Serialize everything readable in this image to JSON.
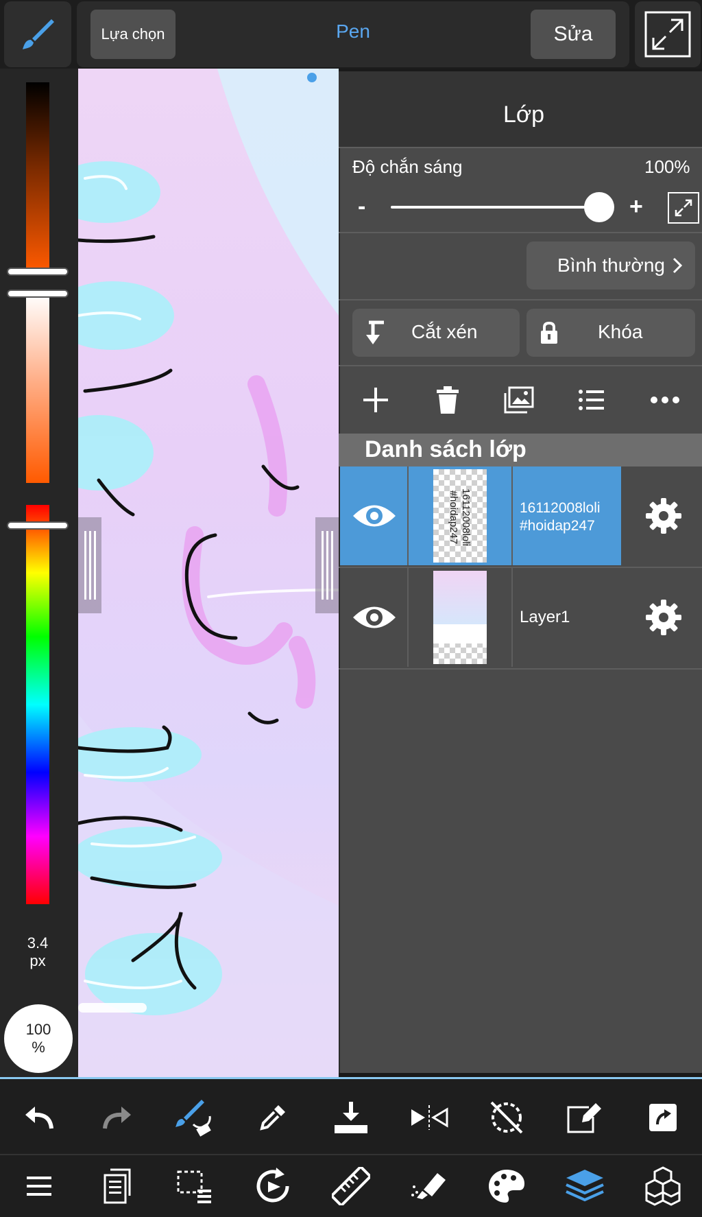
{
  "top_bar": {
    "select_label": "Lựa chọn",
    "tool_name": "Pen",
    "edit_label": "Sửa",
    "icons": [
      "brush-icon",
      "expand-icon"
    ]
  },
  "left_panel": {
    "brush_size": "3.4",
    "brush_size_unit": "px",
    "opacity_value": "100",
    "opacity_unit": "%"
  },
  "layer_panel": {
    "title": "Lớp",
    "opacity_label": "Độ chắn sáng",
    "opacity_value": "100%",
    "opacity_level": 1.0,
    "minus_label": "-",
    "plus_label": "+",
    "blend_mode": "Bình thường",
    "clip_label": "Cắt xén",
    "lock_label": "Khóa",
    "list_title": "Danh sách lớp",
    "layers": [
      {
        "name": "16112008loli\n#hoidap247",
        "name_line1": "16112008loli",
        "name_line2": "#hoidap247",
        "selected": true,
        "visible": true
      },
      {
        "name": "Layer1",
        "selected": false,
        "visible": true
      }
    ],
    "accent_color": "#4d9ad8"
  },
  "bottom_toolbar": {
    "row1": [
      "undo-icon",
      "redo-icon",
      "brush-swap-icon",
      "eyedropper-icon",
      "save-icon",
      "flip-icon",
      "rotate-off-icon",
      "transform-icon",
      "share-icon"
    ],
    "row2": [
      "menu-icon",
      "pages-icon",
      "selection-icon",
      "rotate-canvas-icon",
      "ruler-icon",
      "fill-icon",
      "palette-icon",
      "layers-icon",
      "materials-icon"
    ],
    "active": "layers-icon",
    "active_color": "#4aa0e8"
  }
}
